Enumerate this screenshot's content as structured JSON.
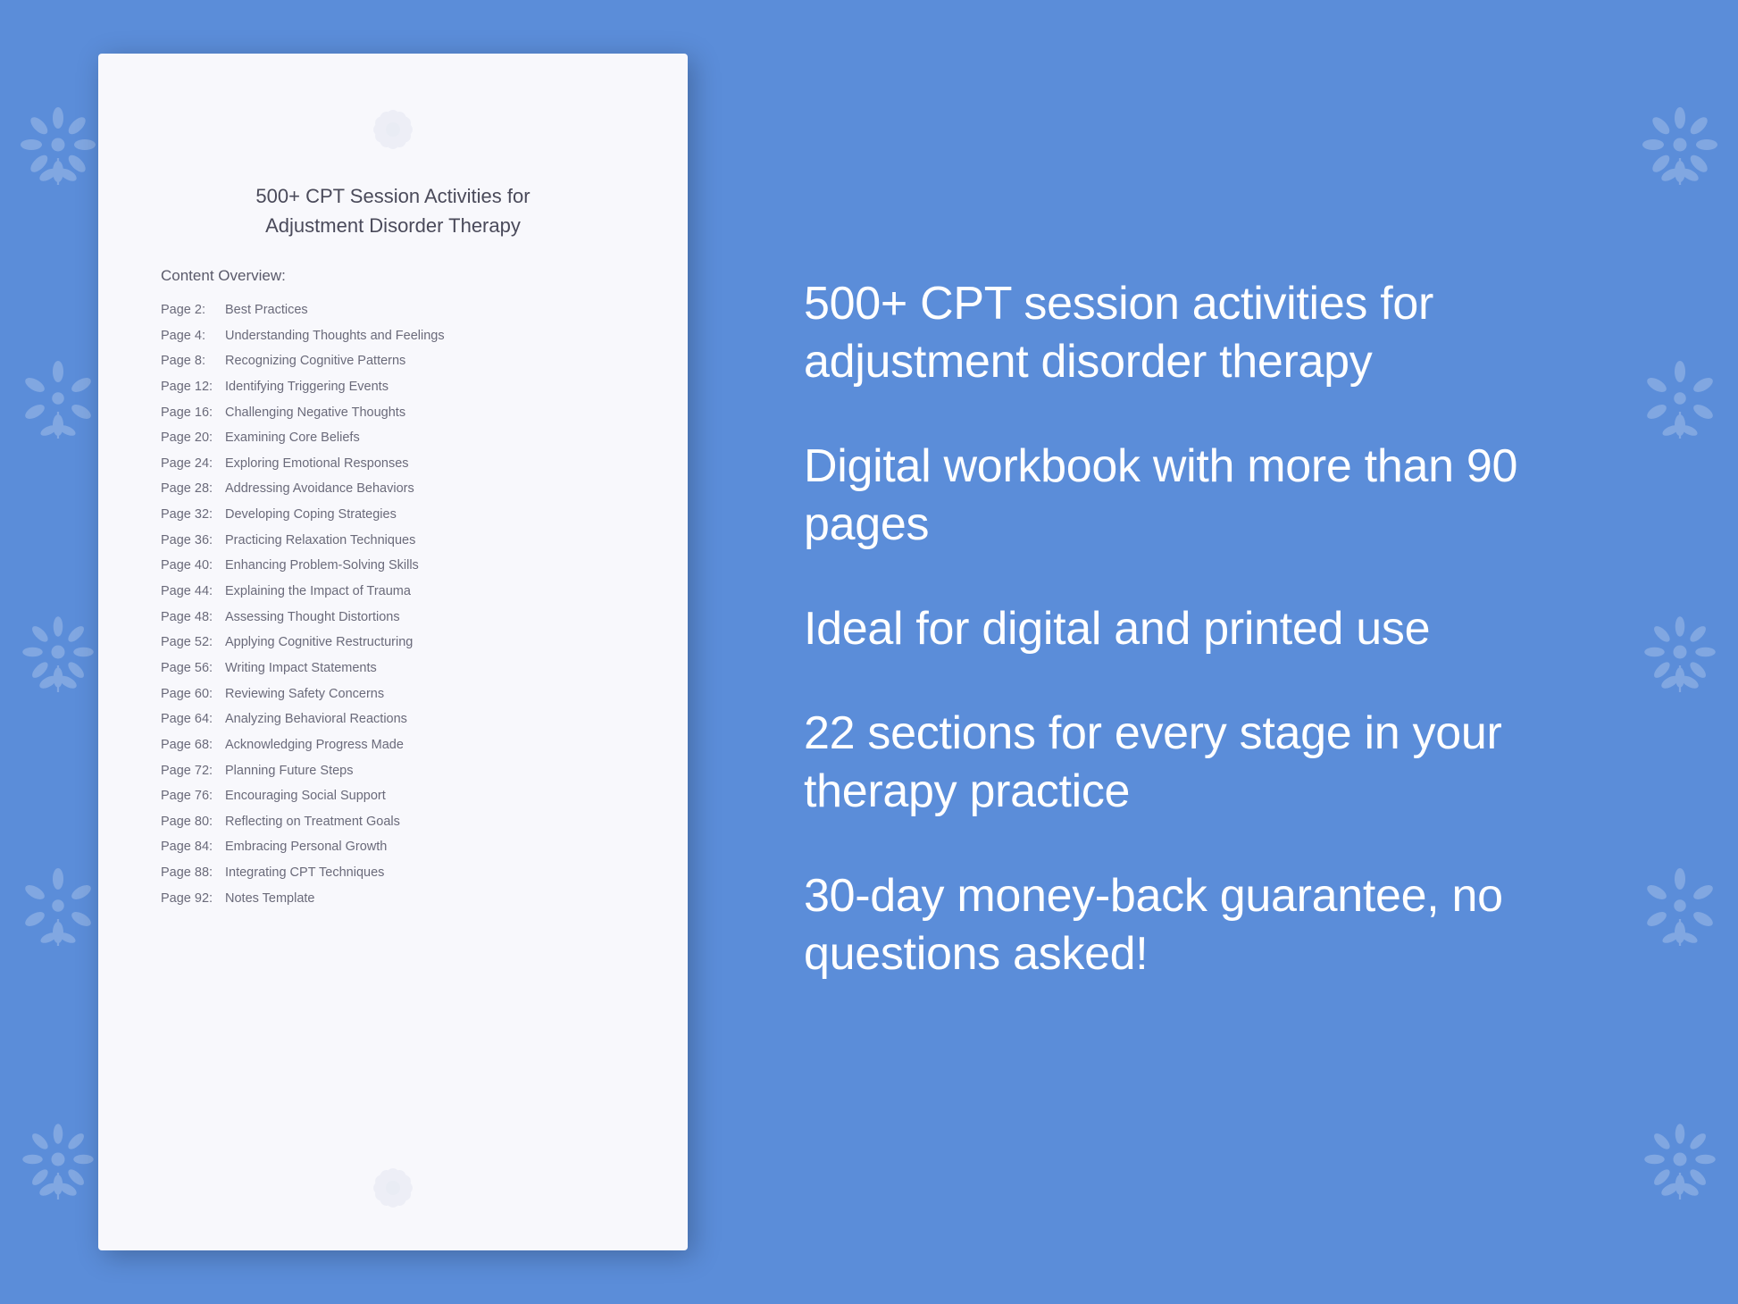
{
  "background": {
    "color": "#5b8dd9"
  },
  "document": {
    "title_line1": "500+ CPT Session Activities for",
    "title_line2": "Adjustment Disorder Therapy",
    "content_label": "Content Overview:",
    "toc": [
      {
        "page": "Page  2:",
        "title": "Best Practices"
      },
      {
        "page": "Page  4:",
        "title": "Understanding Thoughts and Feelings"
      },
      {
        "page": "Page  8:",
        "title": "Recognizing Cognitive Patterns"
      },
      {
        "page": "Page 12:",
        "title": "Identifying Triggering Events"
      },
      {
        "page": "Page 16:",
        "title": "Challenging Negative Thoughts"
      },
      {
        "page": "Page 20:",
        "title": "Examining Core Beliefs"
      },
      {
        "page": "Page 24:",
        "title": "Exploring Emotional Responses"
      },
      {
        "page": "Page 28:",
        "title": "Addressing Avoidance Behaviors"
      },
      {
        "page": "Page 32:",
        "title": "Developing Coping Strategies"
      },
      {
        "page": "Page 36:",
        "title": "Practicing Relaxation Techniques"
      },
      {
        "page": "Page 40:",
        "title": "Enhancing Problem-Solving Skills"
      },
      {
        "page": "Page 44:",
        "title": "Explaining the Impact of Trauma"
      },
      {
        "page": "Page 48:",
        "title": "Assessing Thought Distortions"
      },
      {
        "page": "Page 52:",
        "title": "Applying Cognitive Restructuring"
      },
      {
        "page": "Page 56:",
        "title": "Writing Impact Statements"
      },
      {
        "page": "Page 60:",
        "title": "Reviewing Safety Concerns"
      },
      {
        "page": "Page 64:",
        "title": "Analyzing Behavioral Reactions"
      },
      {
        "page": "Page 68:",
        "title": "Acknowledging Progress Made"
      },
      {
        "page": "Page 72:",
        "title": "Planning Future Steps"
      },
      {
        "page": "Page 76:",
        "title": "Encouraging Social Support"
      },
      {
        "page": "Page 80:",
        "title": "Reflecting on Treatment Goals"
      },
      {
        "page": "Page 84:",
        "title": "Embracing Personal Growth"
      },
      {
        "page": "Page 88:",
        "title": "Integrating CPT Techniques"
      },
      {
        "page": "Page 92:",
        "title": "Notes Template"
      }
    ]
  },
  "right_panel": {
    "blocks": [
      {
        "id": "block1",
        "text": "500+ CPT session activities for adjustment disorder therapy"
      },
      {
        "id": "block2",
        "text": "Digital workbook with more than 90 pages"
      },
      {
        "id": "block3",
        "text": "Ideal for digital and printed use"
      },
      {
        "id": "block4",
        "text": "22 sections for every stage in your therapy practice"
      },
      {
        "id": "block5",
        "text": "30-day money-back guarantee, no questions asked!"
      }
    ]
  }
}
